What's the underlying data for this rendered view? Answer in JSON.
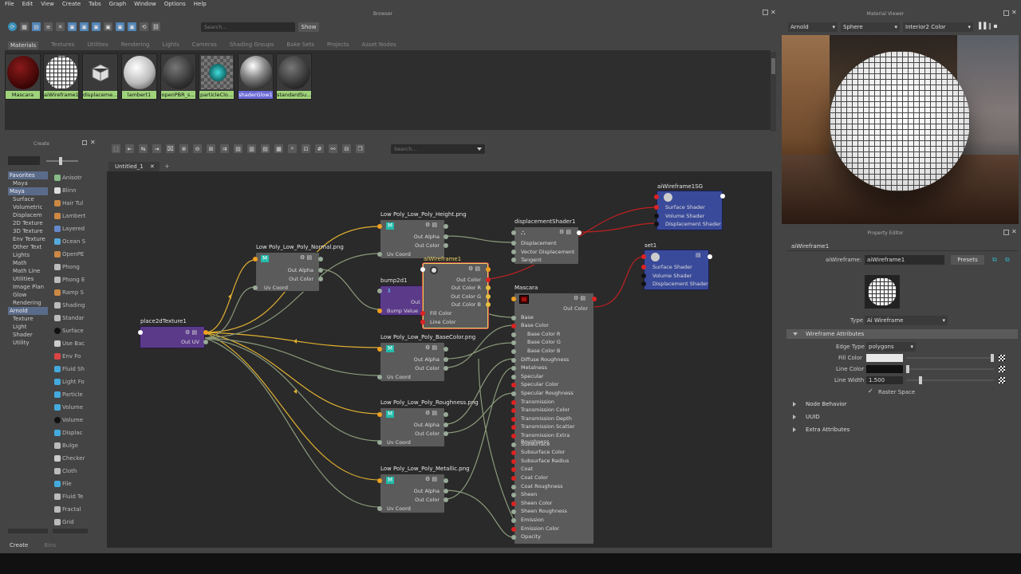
{
  "menu": [
    "File",
    "Edit",
    "View",
    "Create",
    "Tabs",
    "Graph",
    "Window",
    "Options",
    "Help"
  ],
  "browser": {
    "title": "Browser",
    "search_placeholder": "Search...",
    "show_label": "Show",
    "tabs": [
      "Materials",
      "Textures",
      "Utilities",
      "Rendering",
      "Lights",
      "Cameras",
      "Shading Groups",
      "Bake Sets",
      "Projects",
      "Asset Nodes"
    ],
    "swatches": [
      "Mascara",
      "aiWireframe1",
      "displaceme...",
      "lambert1",
      "openPBR_s...",
      "particleClo...",
      "shaderGlow1",
      "standardSu..."
    ]
  },
  "create_panel": {
    "title": "Create",
    "tree": [
      {
        "label": "Favorites",
        "sec": true
      },
      {
        "label": "Maya"
      },
      {
        "label": "Maya",
        "sec": true
      },
      {
        "label": "Surface"
      },
      {
        "label": "Volumetric"
      },
      {
        "label": "Displacem"
      },
      {
        "label": "2D Texture"
      },
      {
        "label": "3D Texture"
      },
      {
        "label": "Env Texture"
      },
      {
        "label": "Other Text"
      },
      {
        "label": "Lights"
      },
      {
        "label": "Math"
      },
      {
        "label": "Math Line"
      },
      {
        "label": "Utilities"
      },
      {
        "label": "Image Plan"
      },
      {
        "label": "Glow"
      },
      {
        "label": "Rendering"
      },
      {
        "label": "Arnold",
        "sec": true
      },
      {
        "label": "Texture"
      },
      {
        "label": "Light"
      },
      {
        "label": "Shader"
      },
      {
        "label": "Utility"
      }
    ],
    "nodes": [
      "Anisotr",
      "Blinn",
      "Hair Tul",
      "Lambert",
      "Layered",
      "Ocean S",
      "OpenPE",
      "Phong",
      "Phong E",
      "Ramp S",
      "Shading",
      "Standar",
      "Surface",
      "Use Bac",
      "Env Fo",
      "Fluid Sh",
      "Light Fo",
      "Particle",
      "Volume",
      "Volume",
      "Displac",
      "Bulge",
      "Checker",
      "Cloth",
      "File",
      "Fluid Te",
      "Fractal",
      "Grid"
    ],
    "bottom_tabs": [
      "Create",
      "Bins"
    ]
  },
  "graph": {
    "search_placeholder": "Search...",
    "tab_label": "Untitled_1",
    "nodes": {
      "place2d": {
        "title": "place2dTexture1",
        "rows": [
          "Out UV"
        ]
      },
      "normal": {
        "title": "Low Poly_Low_Poly_Normal.png",
        "rows": [
          "Out Alpha",
          "Out Color",
          "Uv Coord"
        ]
      },
      "height": {
        "title": "Low Poly_Low_Poly_Height.png",
        "rows": [
          "Out Alpha",
          "Out Color",
          "Uv Coord"
        ]
      },
      "bump": {
        "title": "bump2d1",
        "rows": [
          "Out",
          "Bump Value"
        ]
      },
      "wire": {
        "title": "aiWireframe1",
        "rows": [
          "Out Color",
          "Out Color R",
          "Out Color G",
          "Out Color B",
          "Fill Color",
          "Line Color"
        ]
      },
      "disp": {
        "title": "displacementShader1",
        "rows": [
          "Displacement",
          "Vector Displacement",
          "Tangent"
        ]
      },
      "basecolor": {
        "title": "Low Poly_Low_Poly_BaseColor.png",
        "rows": [
          "Out Alpha",
          "Out Color",
          "Uv Coord"
        ]
      },
      "rough": {
        "title": "Low Poly_Low_Poly_Roughness.png",
        "rows": [
          "Out Alpha",
          "Out Color",
          "Uv Coord"
        ]
      },
      "metal": {
        "title": "Low Poly_Low_Poly_Metallic.png",
        "rows": [
          "Out Alpha",
          "Out Color",
          "Uv Coord"
        ]
      },
      "mascara": {
        "title": "Mascara",
        "rows": [
          "Out Color",
          "Base",
          "Base Color",
          "Base Color R",
          "Base Color G",
          "Base Color B",
          "Diffuse Roughness",
          "Metalness",
          "Specular",
          "Specular Color",
          "Specular Roughness",
          "Transmission",
          "Transmission Color",
          "Transmission Depth",
          "Transmission Scatter",
          "Transmission Extra Roughness",
          "Subsurface",
          "Subsurface Color",
          "Subsurface Radius",
          "Coat",
          "Coat Color",
          "Coat Roughness",
          "Sheen",
          "Sheen Color",
          "Sheen Roughness",
          "Emission",
          "Emission Color",
          "Opacity"
        ]
      },
      "sg": {
        "title": "aiWireframe1SG",
        "rows": [
          "Surface Shader",
          "Volume Shader",
          "Displacement Shader"
        ]
      },
      "set1": {
        "title": "set1",
        "rows": [
          "Surface Shader",
          "Volume Shader",
          "Displacement Shader"
        ]
      }
    }
  },
  "material_viewer": {
    "title": "Material Viewer",
    "renderer": "Arnold",
    "shape": "Sphere",
    "env": "Interior2 Color"
  },
  "property_editor": {
    "title": "Property Editor",
    "node_name": "aiWireframe1",
    "field_label": "aiWireframe:",
    "field_value": "aiWireframe1",
    "presets_label": "Presets",
    "type_label": "Type",
    "type_value": "Ai Wireframe",
    "section_wire": "Wireframe Attributes",
    "edge_type_label": "Edge Type",
    "edge_type_value": "polygons",
    "fill_color_label": "Fill Color",
    "line_color_label": "Line Color",
    "line_width_label": "Line Width",
    "line_width_value": "1.500",
    "raster_space_label": "Raster Space",
    "sections": [
      "Node Behavior",
      "UUID",
      "Extra Attributes"
    ],
    "fill_color": "#e8e8e8",
    "line_color": "#111111"
  }
}
